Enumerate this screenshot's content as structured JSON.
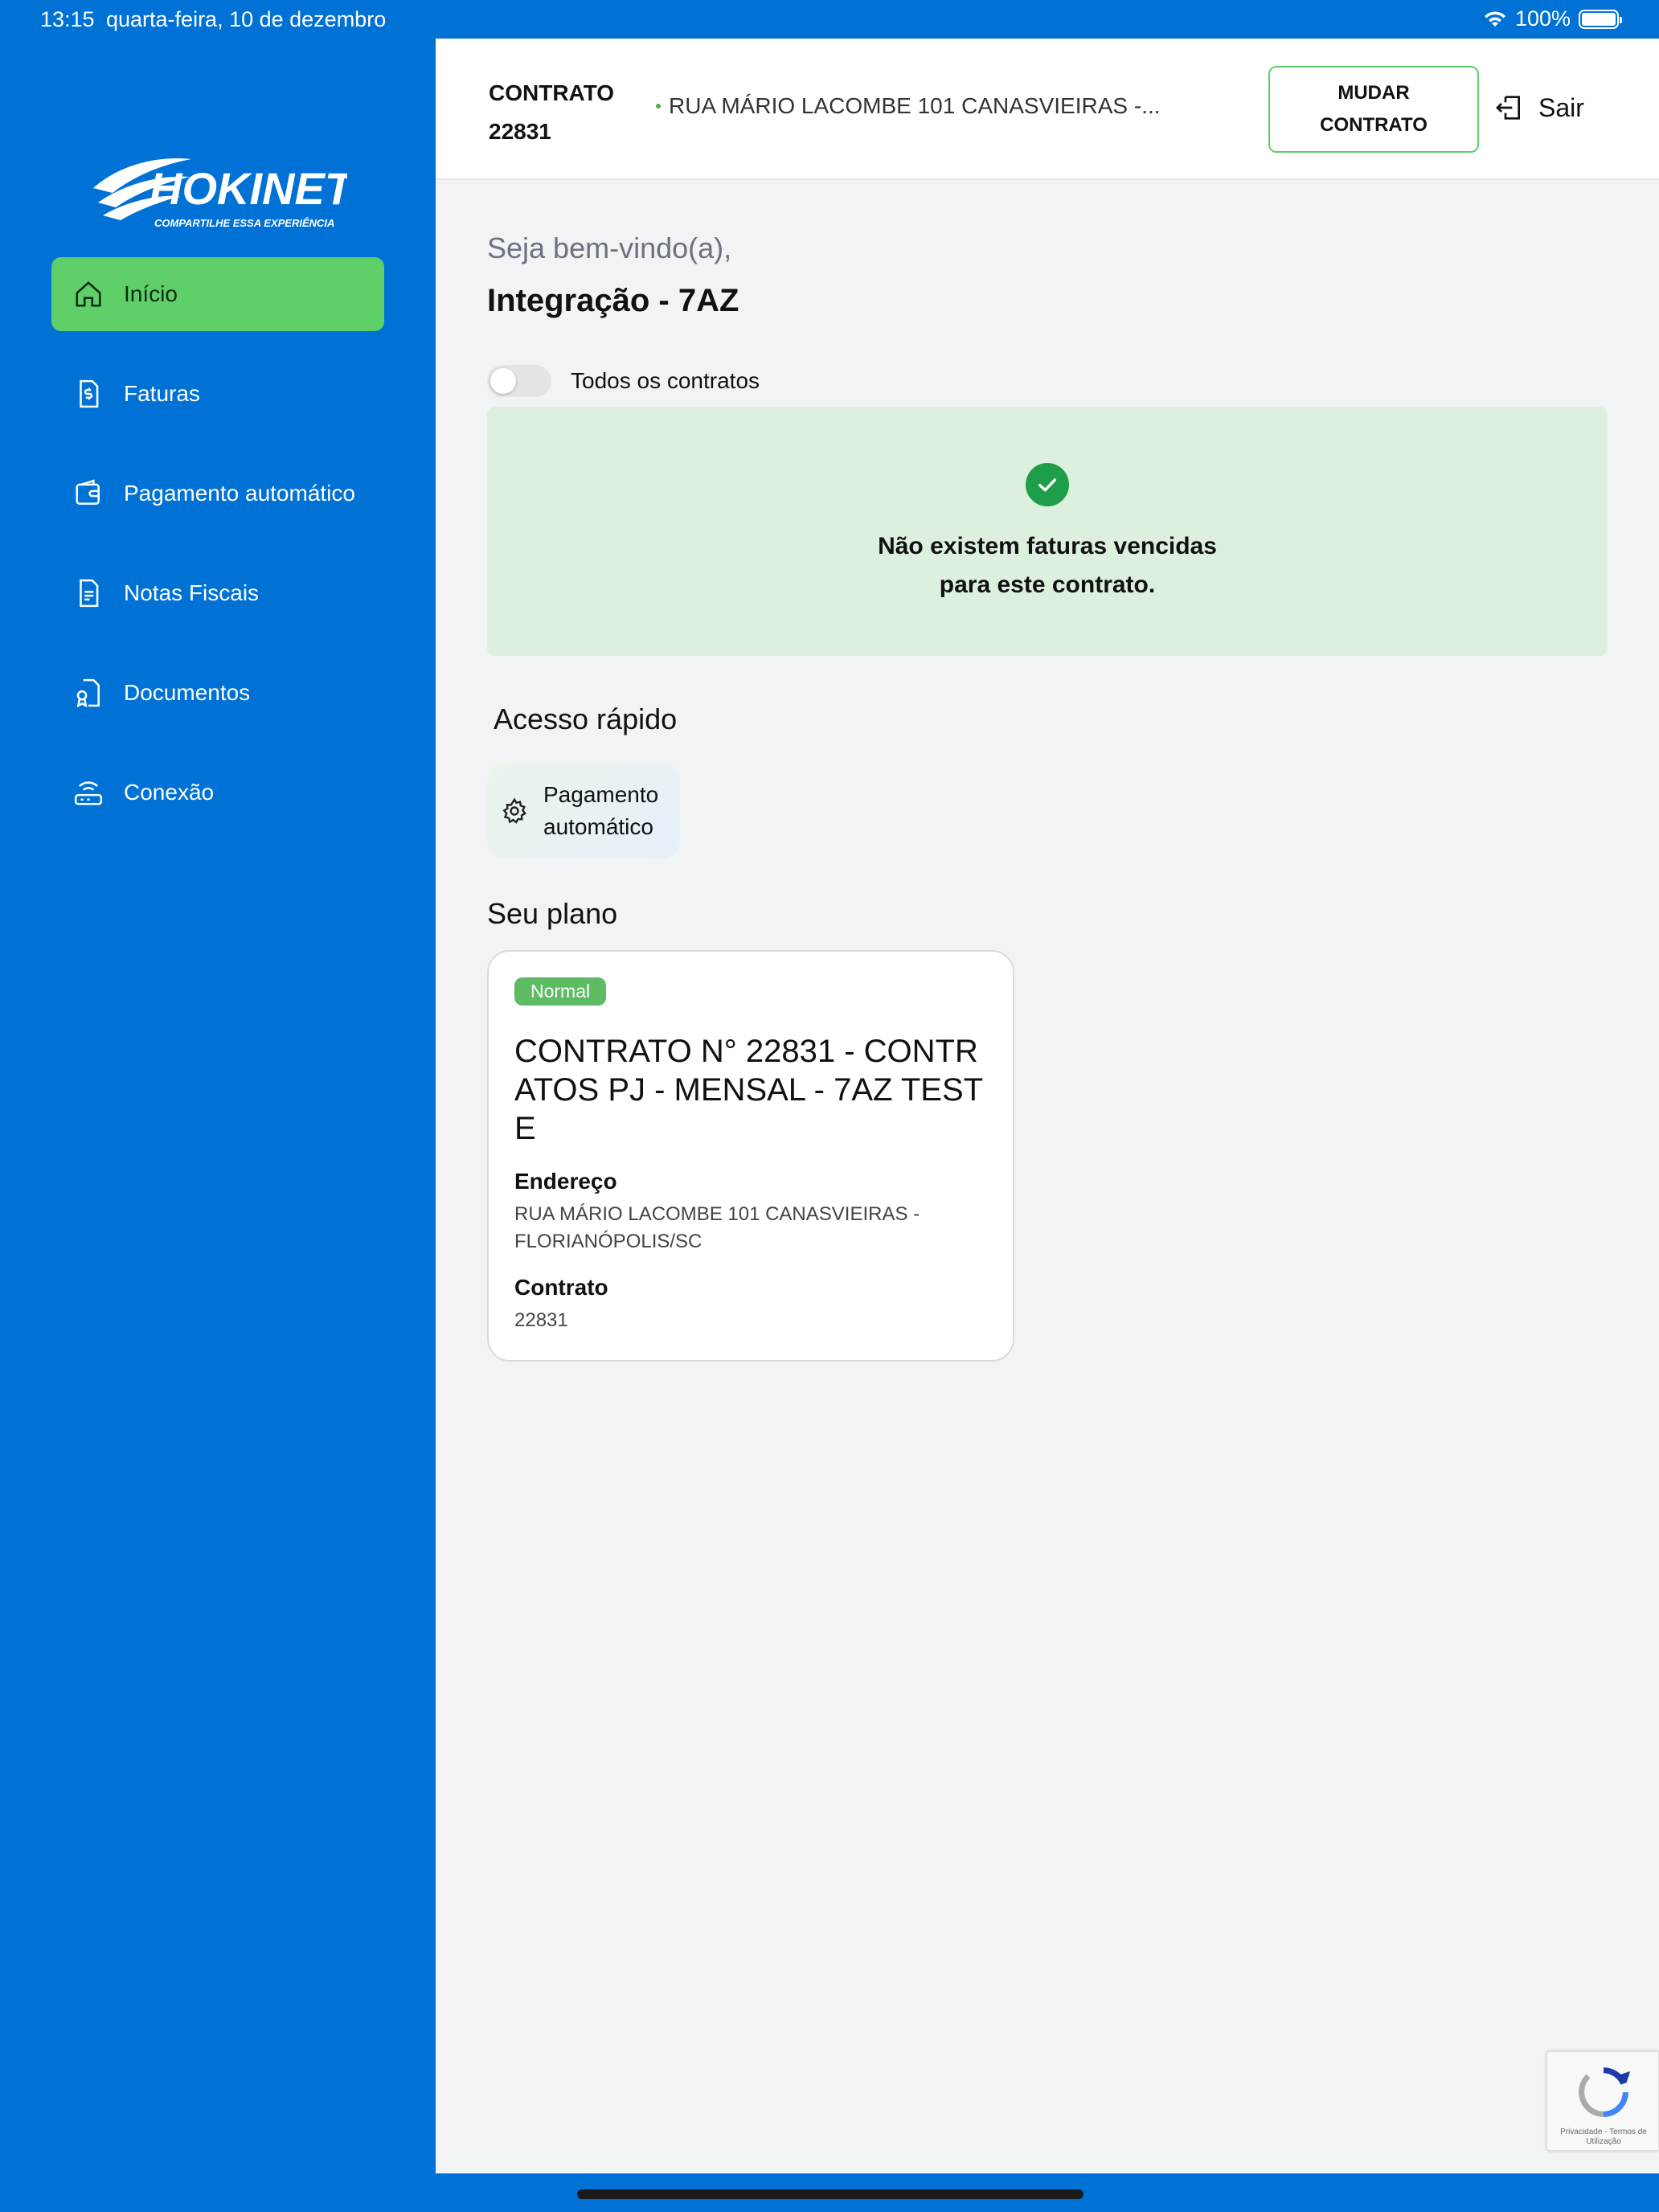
{
  "status_bar": {
    "time": "13:15",
    "date": "quarta-feira, 10 de dezembro",
    "battery": "100%"
  },
  "brand": {
    "name": "HOKINET",
    "tagline": "COMPARTILHE ESSA EXPERIÊNCIA",
    "accent": "#5FCF6A",
    "primary": "#0072D6"
  },
  "sidebar": {
    "items": [
      {
        "label": "Início",
        "icon": "home-icon",
        "active": true
      },
      {
        "label": "Faturas",
        "icon": "invoice-icon"
      },
      {
        "label": "Pagamento automático",
        "icon": "wallet-icon"
      },
      {
        "label": "Notas Fiscais",
        "icon": "document-icon"
      },
      {
        "label": "Documentos",
        "icon": "certificate-icon"
      },
      {
        "label": "Conexão",
        "icon": "router-icon"
      }
    ]
  },
  "header": {
    "contract_label": "CONTRATO",
    "contract_number": "22831",
    "address": "RUA MÁRIO LACOMBE 101 CANASVIEIRAS -...",
    "change_contract_line1": "MUDAR",
    "change_contract_line2": "CONTRATO",
    "logout_label": "Sair"
  },
  "main": {
    "greeting": "Seja bem-vindo(a),",
    "username": "Integração - 7AZ",
    "toggle_label": "Todos os contratos",
    "toggle_on": false,
    "alert_line1": "Não existem faturas vencidas",
    "alert_line2": "para este contrato.",
    "quick_access_title": "Acesso rápido",
    "quick_access_item_line1": "Pagamento",
    "quick_access_item_line2": "automático",
    "plan_section_title": "Seu plano"
  },
  "plan": {
    "badge": "Normal",
    "title": "CONTRATO N° 22831 - CONTRATOS PJ - MENSAL - 7AZ TESTE",
    "address_label": "Endereço",
    "address_value": "RUA MÁRIO LACOMBE 101 CANASVIEIRAS - FLORIANÓPOLIS/SC",
    "contract_label": "Contrato",
    "contract_value": "22831"
  },
  "recaptcha": {
    "text": "Privacidade - Termos de Utilização"
  }
}
